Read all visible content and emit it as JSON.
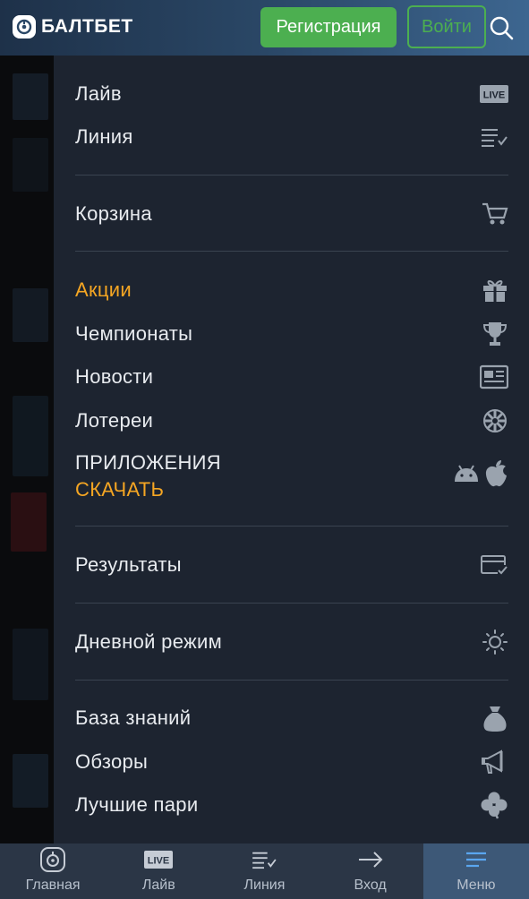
{
  "header": {
    "logo_text": "БАЛТБЕТ",
    "register_label": "Регистрация",
    "login_label": "Войти"
  },
  "menu": {
    "live": "Лайв",
    "line": "Линия",
    "cart": "Корзина",
    "promos": "Акции",
    "championships": "Чемпионаты",
    "news": "Новости",
    "lotteries": "Лотереи",
    "apps_title": "ПРИЛОЖЕНИЯ",
    "apps_download": "СКАЧАТЬ",
    "results": "Результаты",
    "day_mode": "Дневной режим",
    "knowledge_base": "База знаний",
    "reviews": "Обзоры",
    "best_bets": "Лучшие пари",
    "live_badge": "LIVE"
  },
  "bottom_nav": {
    "home": "Главная",
    "live": "Лайв",
    "line": "Линия",
    "login": "Вход",
    "menu": "Меню",
    "live_badge": "LIVE"
  },
  "colors": {
    "accent": "#f5a623",
    "primary_green": "#4caf50",
    "drawer_bg": "#1d2430",
    "nav_bg": "#2b3646",
    "nav_active": "#3d5877"
  }
}
